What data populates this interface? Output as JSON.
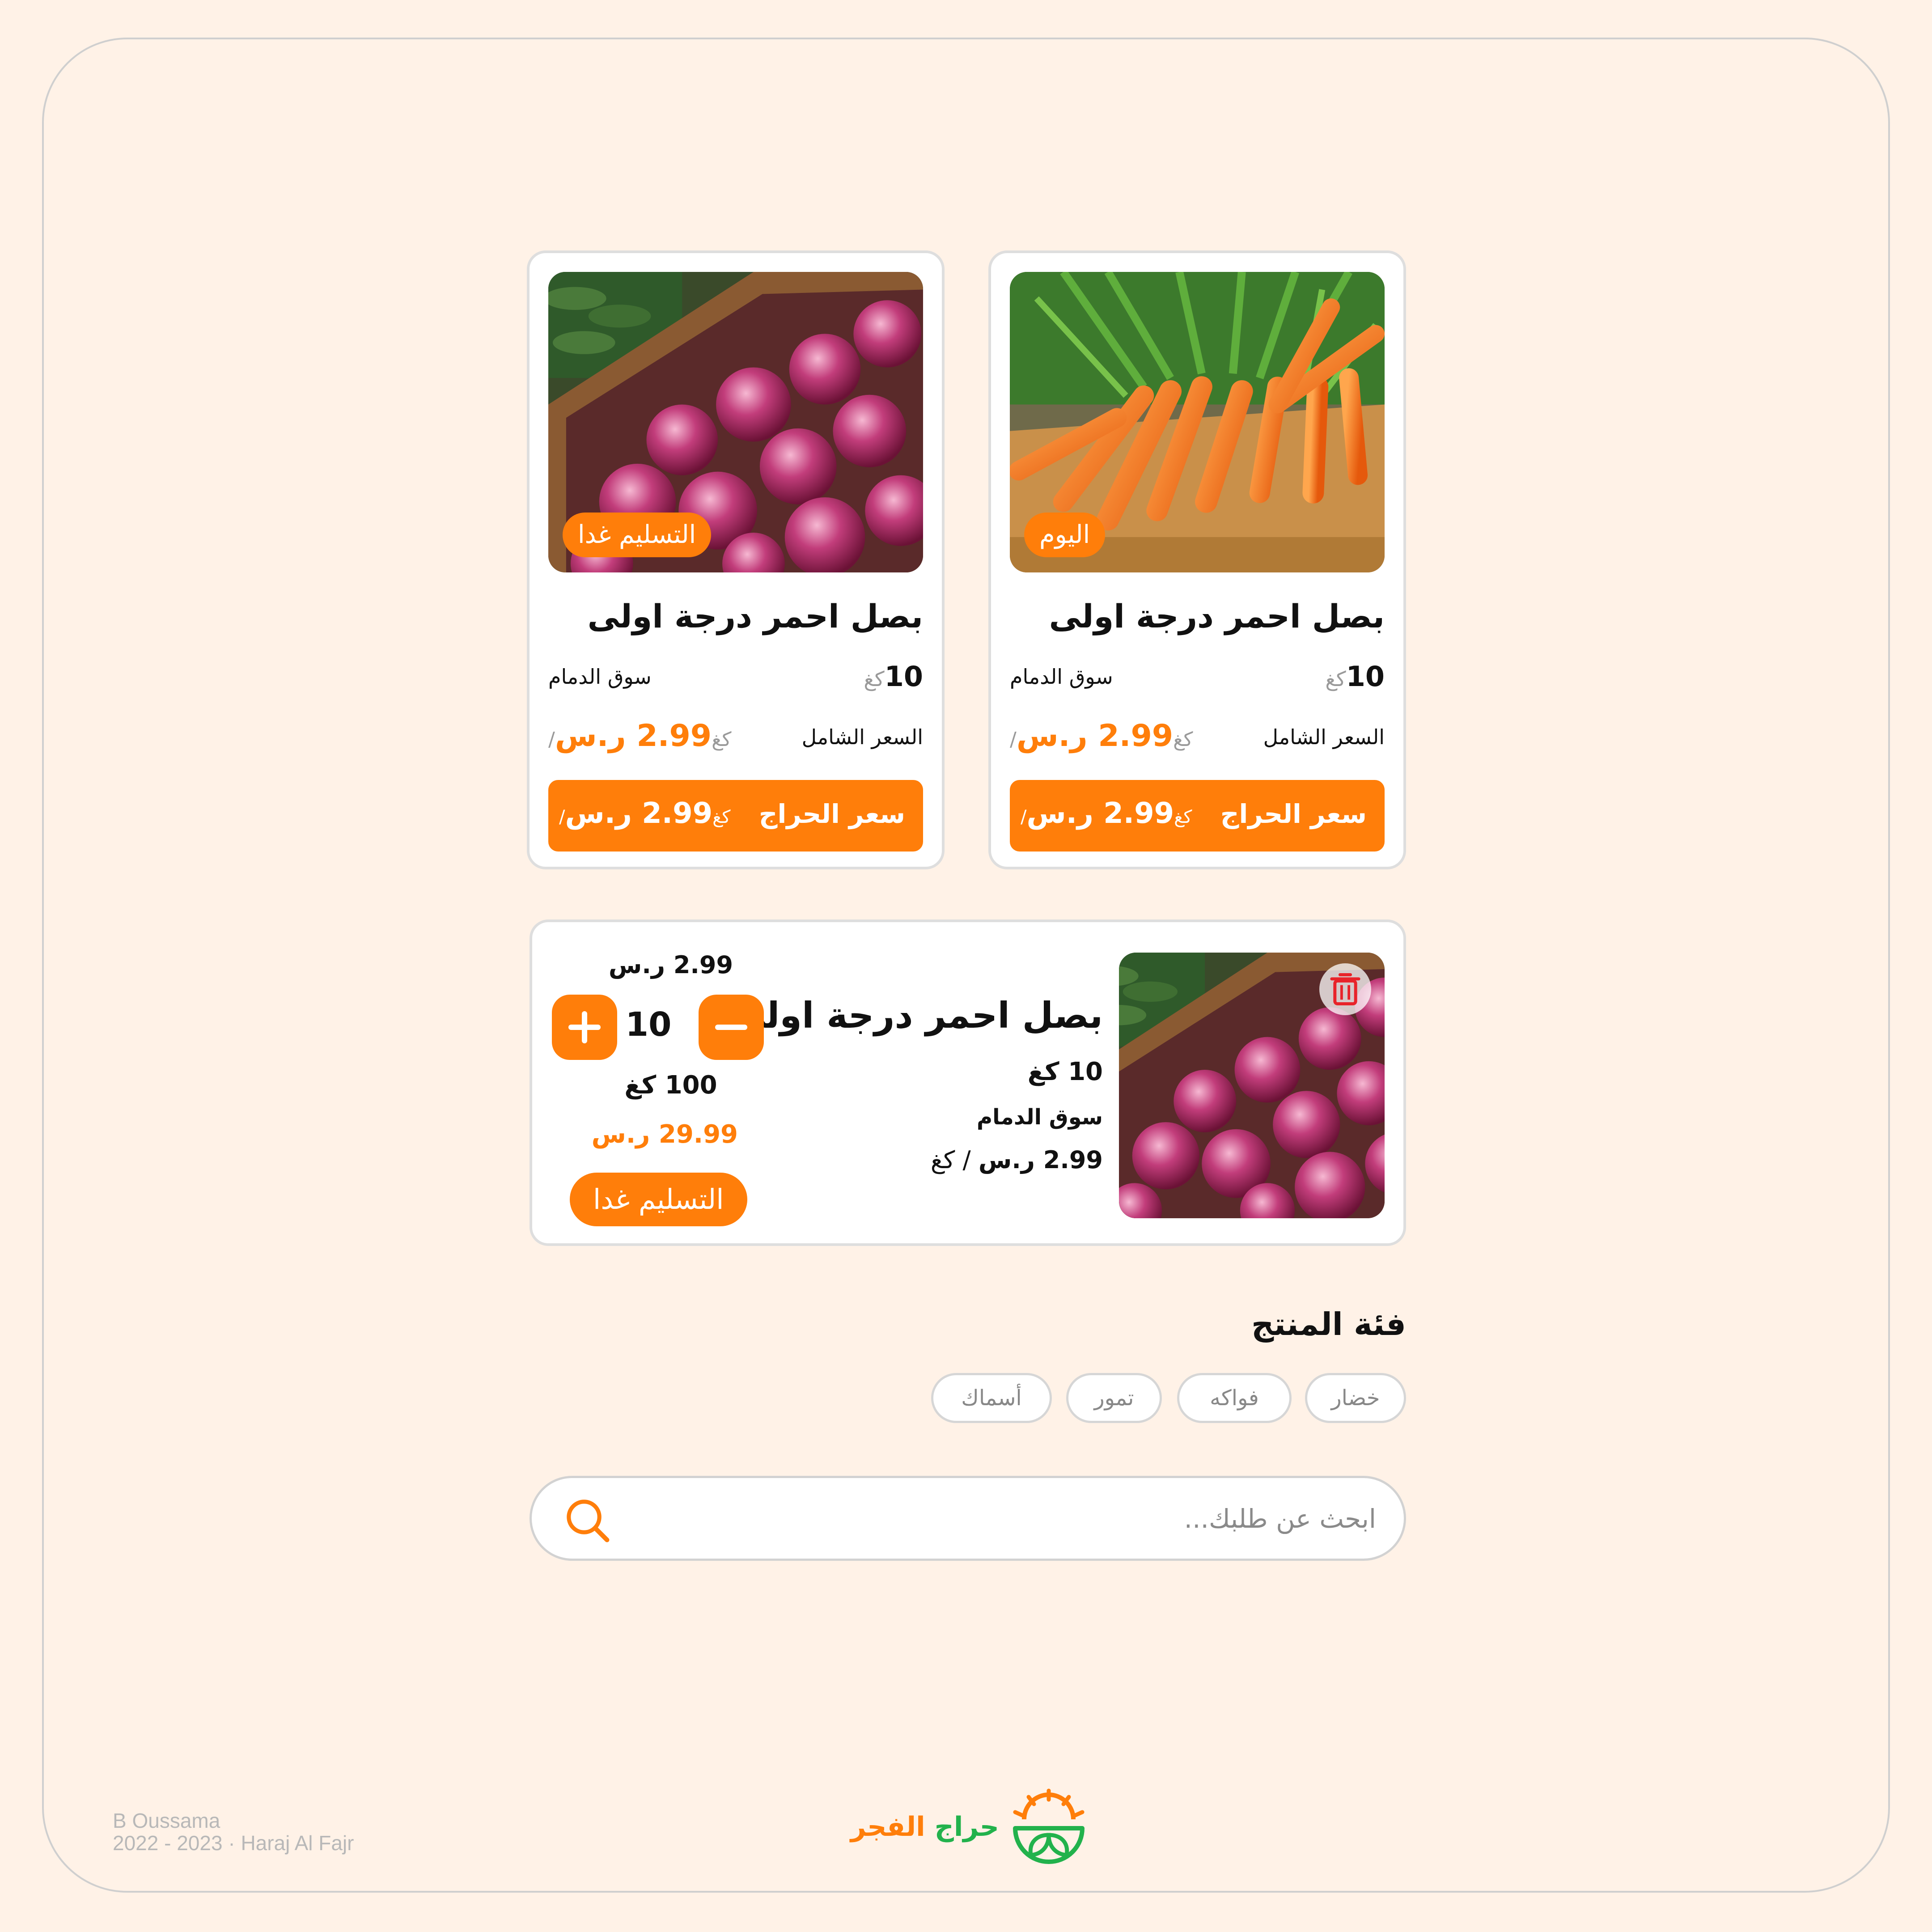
{
  "colors": {
    "accent": "#ff7e0a",
    "background": "#fff2e7",
    "card": "#ffffff",
    "border": "#dedede",
    "logo_green": "#22b24c"
  },
  "cards": [
    {
      "badge": "التسليم غدا",
      "title": "بصل احمر درجة اولى",
      "qty": "10",
      "qty_unit": "كغ",
      "market": "سوق الدمام",
      "price_label": "السعر الشامل",
      "price": "2.99 ر.س",
      "per_unit": "/كغ",
      "haraj_label": "سعر الحراج",
      "haraj_price": "2.99 ر.س",
      "haraj_unit": "/كغ",
      "image": "red-onions-photo"
    },
    {
      "badge": "اليوم",
      "title": "بصل احمر درجة اولى",
      "qty": "10",
      "qty_unit": "كغ",
      "market": "سوق الدمام",
      "price_label": "السعر الشامل",
      "price": "2.99 ر.س",
      "per_unit": "/كغ",
      "haraj_label": "سعر الحراج",
      "haraj_price": "2.99 ر.س",
      "haraj_unit": "/كغ",
      "image": "carrots-photo"
    }
  ],
  "cart_item": {
    "title": "بصل احمر درجة اولى",
    "weight": "10 كغ",
    "market": "سوق الدمام",
    "unit_price": "2.99 ر.س",
    "unit_sep": "/",
    "unit": "كغ",
    "price_top": "2.99 ر.س",
    "quantity": "10",
    "total_weight": "100 كغ",
    "total_price": "29.99 ر.س",
    "delivery": "التسليم غدا",
    "image": "red-onions-photo",
    "delete_icon": "trash-icon"
  },
  "category": {
    "title": "فئة المنتج",
    "chips": [
      "خضار",
      "فواكه",
      "تمور",
      "أسماك"
    ]
  },
  "search": {
    "placeholder": "ابحث عن طلبك...",
    "icon": "search-icon"
  },
  "footer": {
    "author": "B Oussama",
    "years": "2022 - 2023",
    "sep": "·",
    "project": "Haraj Al Fajr",
    "logo_text_1": "حراج",
    "logo_text_2": "الفجر"
  }
}
